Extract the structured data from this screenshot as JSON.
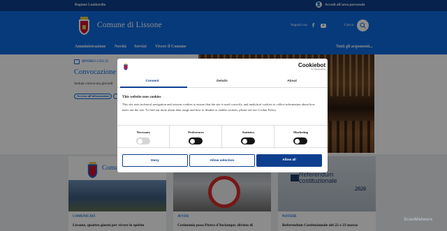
{
  "topbar": {
    "region": "Regione Lombardia",
    "login_label": "Accedi all'area personale"
  },
  "header": {
    "title": "Comune di Lissone",
    "social_label": "Seguici su:",
    "search_label": "Cerca",
    "nav": [
      "Amministrazione",
      "Novità",
      "Servizi",
      "Vivere il Comune"
    ],
    "all_topics": "Tutti gli argomenti..."
  },
  "hero": {
    "tag": "AVVISI",
    "date": "16 GEN 26",
    "title": "Convocazione C",
    "description": "Seduta convocata giovedì",
    "chip": "Accesso all'informazione"
  },
  "cards": [
    {
      "logo_text": "Comune",
      "tag": "COMUNICATI",
      "title": "Lissone, quattro giorni per vivere lo spirito"
    },
    {
      "tag": "AVVISI",
      "title": "Cerimonia posa Pietra d'Inciampo: divieto di"
    },
    {
      "image_text": "Referendum costituzionale",
      "image_year": "2026",
      "tag": "NOTIZIE",
      "title": "Referendum Costituzionale del 22 e 23 marzo"
    }
  ],
  "cookie": {
    "brand": "Cookiebot",
    "brand_sub": "by Usercentrics",
    "tabs": [
      "Consent",
      "Details",
      "About"
    ],
    "heading": "This website uses cookies",
    "body": "This site uses technical navigation and session cookies to ensure that the site is used correctly, and analytical cookies to collect information about how users use the site. To find out more about data usage and how to disable or enable cookies, please see our Cookie Policy.",
    "categories": [
      {
        "label": "Necessary",
        "enabled": true
      },
      {
        "label": "Preferences",
        "enabled": false
      },
      {
        "label": "Statistics",
        "enabled": false
      },
      {
        "label": "Marketing",
        "enabled": false
      }
    ],
    "buttons": {
      "deny": "Deny",
      "selection": "Allow selection",
      "all": "Allow all"
    }
  },
  "watermark": "ScanMalware",
  "colors": {
    "brand_blue": "#0e6ae0",
    "dark_blue": "#0b3f8d",
    "cookie_blue": "#0e3f8f"
  }
}
